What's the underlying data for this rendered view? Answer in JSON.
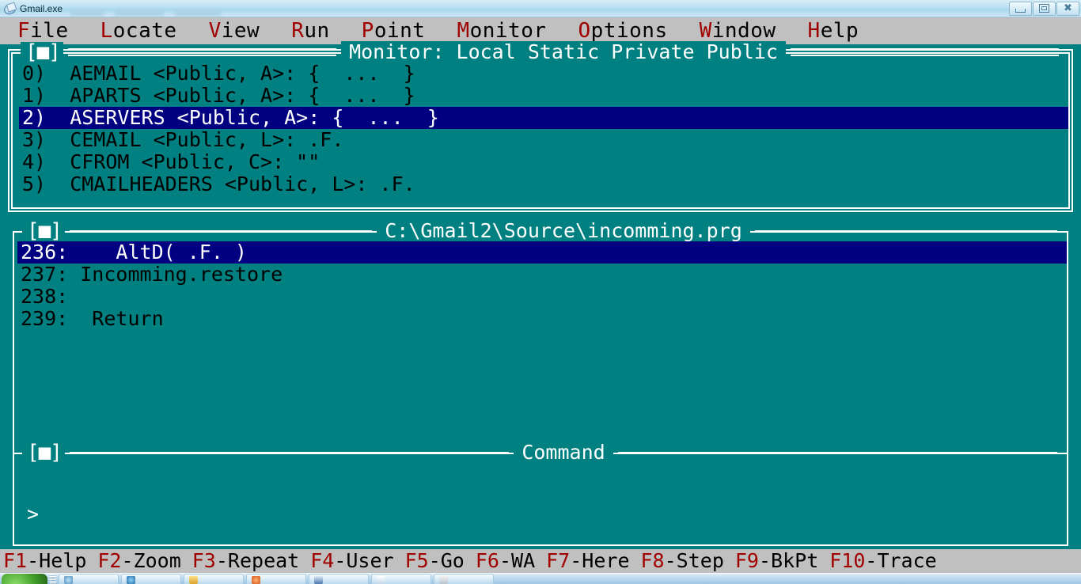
{
  "window": {
    "title": "Gmail.exe",
    "icon": "app-icon",
    "buttons": {
      "minimize": "minimize",
      "restore": "restore",
      "close": "close"
    }
  },
  "menubar": {
    "items": [
      {
        "hot": "F",
        "rest": "ile"
      },
      {
        "hot": "L",
        "rest": "ocate"
      },
      {
        "hot": "V",
        "rest": "iew"
      },
      {
        "hot": "R",
        "rest": "un"
      },
      {
        "hot": "P",
        "rest": "oint"
      },
      {
        "hot": "M",
        "rest": "onitor"
      },
      {
        "hot": "O",
        "rest": "ptions"
      },
      {
        "hot": "W",
        "rest": "indow"
      },
      {
        "hot": "H",
        "rest": "elp"
      }
    ]
  },
  "monitor_window": {
    "closebox": "[■]",
    "title": "Monitor: Local Static Private Public",
    "rows": [
      {
        "text": "0)  AEMAIL <Public, A>: {  ...  }",
        "selected": false
      },
      {
        "text": "1)  APARTS <Public, A>: {  ...  }",
        "selected": false
      },
      {
        "text": "2)  ASERVERS <Public, A>: {  ...  }",
        "selected": true
      },
      {
        "text": "3)  CEMAIL <Public, L>: .F.",
        "selected": false
      },
      {
        "text": "4)  CFROM <Public, C>: \"\"",
        "selected": false
      },
      {
        "text": "5)  CMAILHEADERS <Public, L>: .F.",
        "selected": false
      }
    ]
  },
  "source_window": {
    "closebox": "[■]",
    "title": "C:\\Gmail2\\Source\\incomming.prg",
    "rows": [
      {
        "text": "236:    AltD( .F. )",
        "selected": true
      },
      {
        "text": "237: Incomming.restore",
        "selected": false
      },
      {
        "text": "238:",
        "selected": false
      },
      {
        "text": "239:  Return",
        "selected": false
      }
    ]
  },
  "command_window": {
    "closebox": "[■]",
    "title": "Command",
    "prompt": ">"
  },
  "fkeybar": {
    "keys": [
      {
        "hot": "F1",
        "rest": "-Help"
      },
      {
        "hot": "F2",
        "rest": "-Zoom"
      },
      {
        "hot": "F3",
        "rest": "-Repeat"
      },
      {
        "hot": "F4",
        "rest": "-User"
      },
      {
        "hot": "F5",
        "rest": "-Go"
      },
      {
        "hot": "F6",
        "rest": "-WA"
      },
      {
        "hot": "F7",
        "rest": "-Here"
      },
      {
        "hot": "F8",
        "rest": "-Step"
      },
      {
        "hot": "F9",
        "rest": "-BkPt"
      },
      {
        "hot": "F10",
        "rest": "-Trace"
      }
    ]
  },
  "colors": {
    "desktop": "#008080",
    "highlight": "#000080",
    "chrome": "#c0c0c0",
    "hotkey": "#a00000",
    "text": "#000000",
    "border": "#ffffff"
  }
}
